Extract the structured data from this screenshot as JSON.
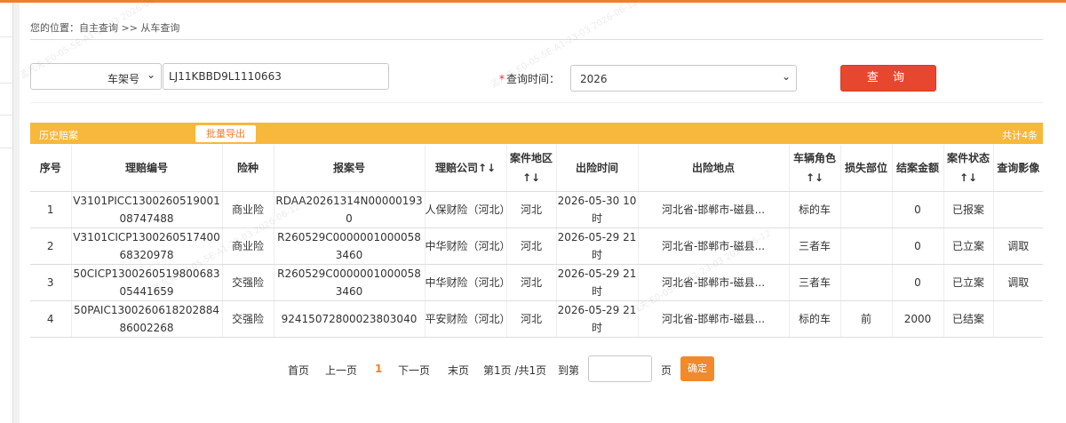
{
  "breadcrumb": "您的位置：自主查询 >> 从车查询",
  "search": {
    "type_value": "车架号",
    "vin_value": "LJ11KBBD9L1110663",
    "time_label": "查询时间：",
    "time_required": "*",
    "year_value": "2026",
    "query_button": "查 询"
  },
  "panel": {
    "title": "历史赔案",
    "export_button": "批量导出",
    "count_text": "共计4条"
  },
  "table": {
    "headers": [
      "序号",
      "理赔编号",
      "险种",
      "报案号",
      "理赔公司↑↓",
      "案件地区↑↓",
      "出险时间",
      "出险地点",
      "车辆角色↑↓",
      "损失部位",
      "结案金额",
      "案件状态↑↓",
      "查询影像"
    ],
    "rows": [
      [
        "1",
        "V3101PICC130026051900108747488",
        "商业险",
        "RDAA20261314N000001930",
        "人保财险（河北）",
        "河北",
        "2026-05-30 10时",
        "河北省-邯郸市-磁县...",
        "标的车",
        "",
        "0",
        "已报案",
        ""
      ],
      [
        "2",
        "V3101CICP130026051740068320978",
        "商业险",
        "R260529C00000010000583460",
        "中华财险（河北）",
        "河北",
        "2026-05-29 21时",
        "河北省-邯郸市-磁县...",
        "三者车",
        "",
        "0",
        "已立案",
        "调取"
      ],
      [
        "3",
        "50CICP130026051980068305441659",
        "交强险",
        "R260529C00000010000583460",
        "中华财险（河北）",
        "河北",
        "2026-05-29 21时",
        "河北省-邯郸市-磁县...",
        "三者车",
        "",
        "0",
        "已立案",
        "调取"
      ],
      [
        "4",
        "50PAIC130026061820288486002268",
        "交强险",
        "92415072800023803040",
        "平安财险（河北）",
        "河北",
        "2026-05-29 21时",
        "河北省-邯郸市-磁县...",
        "标的车",
        "前",
        "2000",
        "已结案",
        ""
      ]
    ]
  },
  "pager": {
    "first": "首页",
    "prev": "上一页",
    "current": "1",
    "next": "下一页",
    "last": "末页",
    "info": "第1页 /共1页",
    "goto_label": "到第",
    "page_unit": "页",
    "confirm": "确定"
  },
  "watermark": "孟凡夫 E0-05-5E-A1-23-03 2026-06-12",
  "colors": {
    "accent": "#ef7f2e",
    "panel": "#f7b83c",
    "query_button": "#e8472f",
    "confirm": "#f08a2c"
  }
}
